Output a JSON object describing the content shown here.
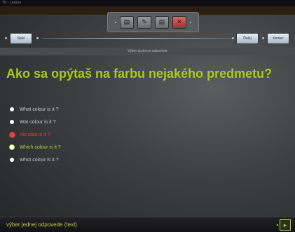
{
  "window": {
    "title": "Tlc - Lesson"
  },
  "toolbar": {
    "icons": [
      "book-icon",
      "edit-icon",
      "page-icon",
      "close-icon"
    ],
    "glyphs": [
      "▤",
      "✎",
      "▤",
      "✕"
    ]
  },
  "nav": {
    "left_label": "Späť",
    "right_left_label": "Ďalej",
    "right_right_label": "Koniec"
  },
  "subtitle": "Výber správnej odpovede",
  "question": "Ako sa opýtaš na farbu nejakého predmetu?",
  "options": [
    {
      "label": "What colour is it ?",
      "state": "default"
    },
    {
      "label": "Wat colour is it ?",
      "state": "default"
    },
    {
      "label": "No idea is it ?",
      "state": "wrong"
    },
    {
      "label": "Which colour is it ?",
      "state": "correct"
    },
    {
      "label": "Whot colour is it ?",
      "state": "default"
    }
  ],
  "footer": {
    "text": "výber jednej odpovede (text)",
    "next_glyph": "▸"
  },
  "colors": {
    "accent_green": "#a6cb17",
    "wrong_red": "#e0453a",
    "footer_yellow": "#c8c14a"
  }
}
